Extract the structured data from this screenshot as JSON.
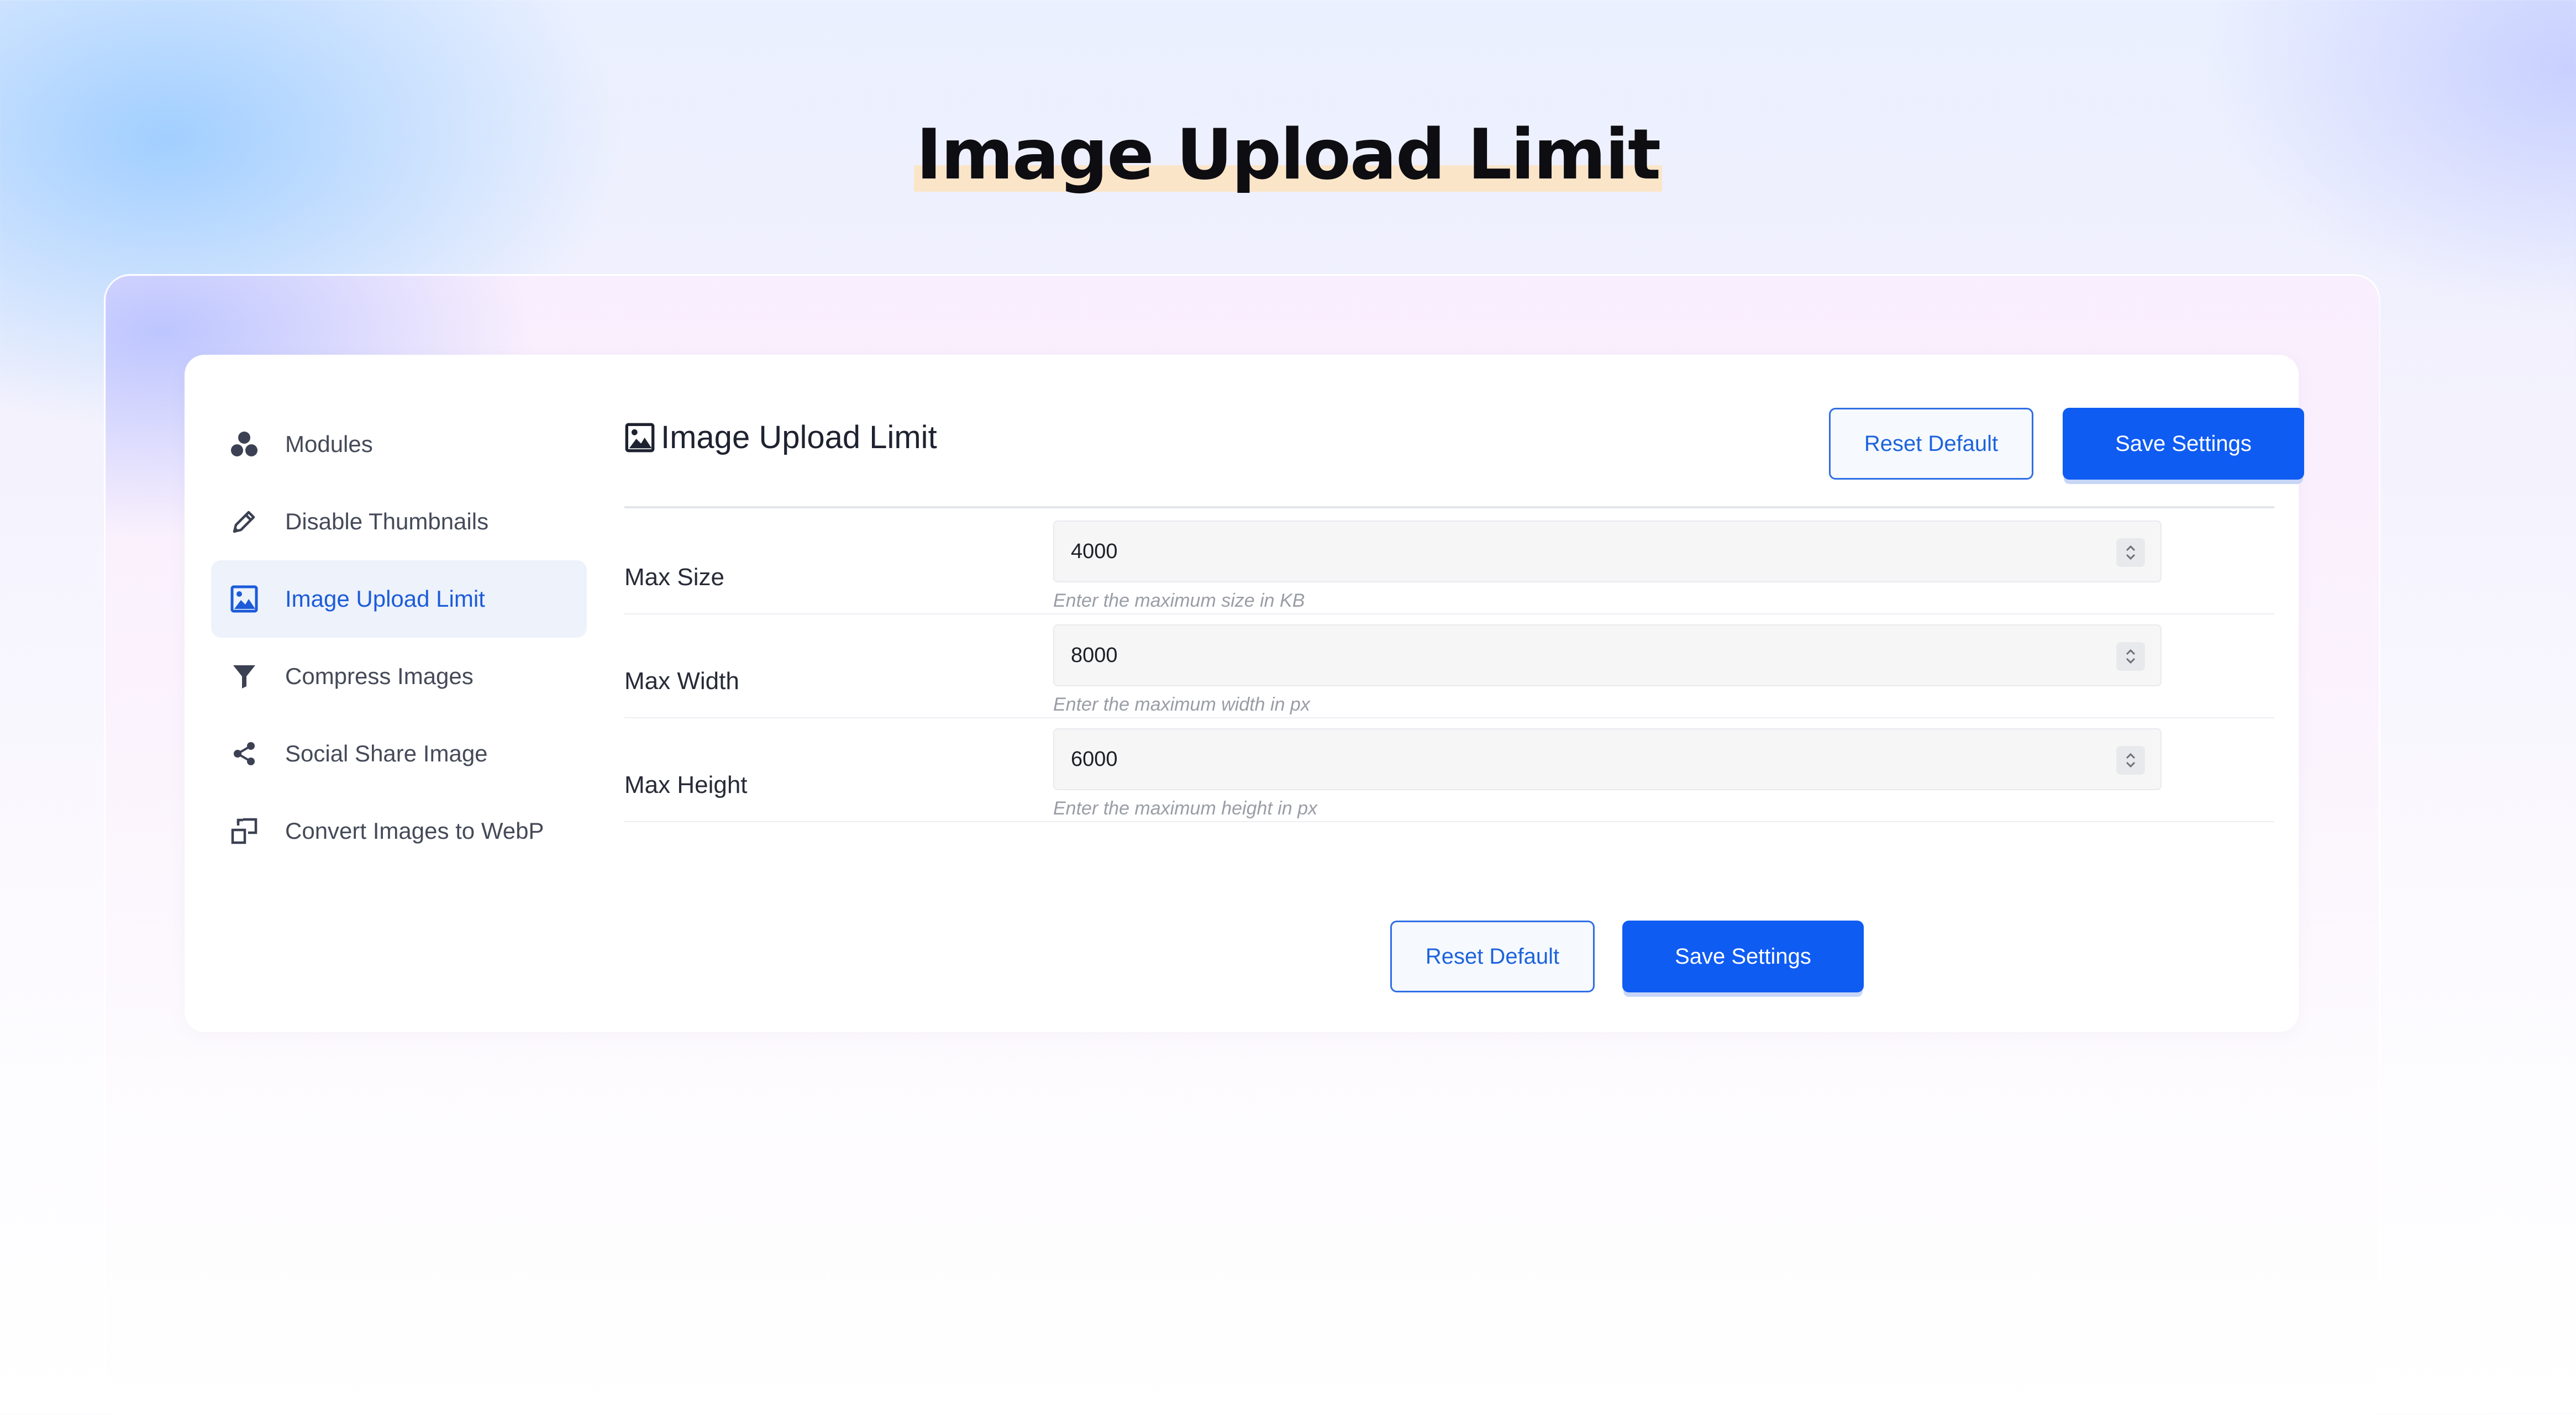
{
  "hero": {
    "title": "Image Upload Limit"
  },
  "sidebar": {
    "items": [
      {
        "label": "Modules",
        "icon": "modules-icon",
        "active": false
      },
      {
        "label": "Disable Thumbnails",
        "icon": "pencil-icon",
        "active": false
      },
      {
        "label": "Image Upload Limit",
        "icon": "image-icon",
        "active": true
      },
      {
        "label": "Compress Images",
        "icon": "funnel-icon",
        "active": false
      },
      {
        "label": "Social Share Image",
        "icon": "share-icon",
        "active": false
      },
      {
        "label": "Convert Images to WebP",
        "icon": "convert-icon",
        "active": false
      }
    ]
  },
  "main": {
    "title": "Image Upload Limit",
    "title_icon": "image-icon",
    "header_buttons": {
      "reset_label": "Reset Default",
      "save_label": "Save Settings"
    },
    "fields": [
      {
        "label": "Max Size",
        "value": "4000",
        "hint": "Enter the maximum size in KB"
      },
      {
        "label": "Max Width",
        "value": "8000",
        "hint": "Enter the maximum width in px"
      },
      {
        "label": "Max Height",
        "value": "6000",
        "hint": "Enter the maximum height in px"
      }
    ],
    "footer_buttons": {
      "reset_label": "Reset Default",
      "save_label": "Save Settings"
    }
  },
  "colors": {
    "accent": "#0f5cf3",
    "active_text": "#1c5bd9",
    "active_bg": "#edf2fb",
    "title_highlight": "#fbe5c8"
  }
}
